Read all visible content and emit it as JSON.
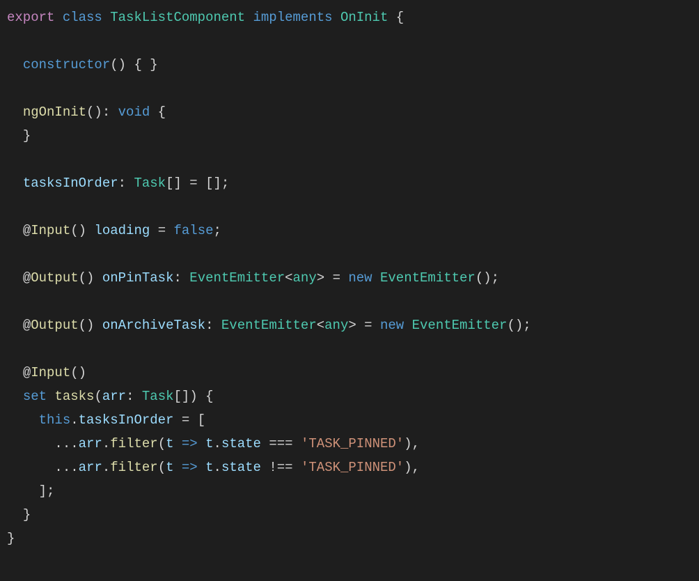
{
  "code": {
    "line1": {
      "kw_export": "export",
      "kw_class": "class",
      "class_name": "TaskListComponent",
      "kw_implements": "implements",
      "iface": "OnInit",
      "brace": "{"
    },
    "line3": {
      "ctor": "constructor",
      "parens": "()",
      "braces": "{ }"
    },
    "line5": {
      "fn": "ngOnInit",
      "parens": "()",
      "colon": ":",
      "ret": "void",
      "brace": "{"
    },
    "line6": {
      "brace": "}"
    },
    "line8": {
      "prop": "tasksInOrder",
      "colon": ":",
      "type": "Task",
      "arr": "[]",
      "eq": "=",
      "val": "[]",
      "semi": ";"
    },
    "line10": {
      "at": "@",
      "dec": "Input",
      "parens": "()",
      "prop": "loading",
      "eq": "=",
      "val": "false",
      "semi": ";"
    },
    "line12": {
      "at": "@",
      "dec": "Output",
      "parens": "()",
      "prop": "onPinTask",
      "colon": ":",
      "type": "EventEmitter",
      "lt": "<",
      "any": "any",
      "gt": ">",
      "eq": "=",
      "new": "new",
      "ctor_type": "EventEmitter",
      "call": "()",
      "semi": ";"
    },
    "line14": {
      "at": "@",
      "dec": "Output",
      "parens": "()",
      "prop": "onArchiveTask",
      "colon": ":",
      "type": "EventEmitter",
      "lt": "<",
      "any": "any",
      "gt": ">",
      "eq": "=",
      "new": "new",
      "ctor_type": "EventEmitter",
      "call": "()",
      "semi": ";"
    },
    "line16": {
      "at": "@",
      "dec": "Input",
      "parens": "()"
    },
    "line17": {
      "set": "set",
      "fn": "tasks",
      "lpar": "(",
      "param": "arr",
      "colon": ":",
      "type": "Task",
      "arr": "[]",
      "rpar": ")",
      "brace": "{"
    },
    "line18": {
      "this": "this",
      "dot": ".",
      "prop": "tasksInOrder",
      "eq": "=",
      "lbrack": "["
    },
    "line19": {
      "spread": "...",
      "arr": "arr",
      "dot": ".",
      "fn": "filter",
      "lpar": "(",
      "p": "t",
      "arrow": "=>",
      "p2": "t",
      "dot2": ".",
      "state": "state",
      "op": "===",
      "str": "'TASK_PINNED'",
      "rpar": ")",
      "comma": ","
    },
    "line20": {
      "spread": "...",
      "arr": "arr",
      "dot": ".",
      "fn": "filter",
      "lpar": "(",
      "p": "t",
      "arrow": "=>",
      "p2": "t",
      "dot2": ".",
      "state": "state",
      "op": "!==",
      "str": "'TASK_PINNED'",
      "rpar": ")",
      "comma": ","
    },
    "line21": {
      "rbrack": "]",
      "semi": ";"
    },
    "line22": {
      "brace": "}"
    },
    "line23": {
      "brace": "}"
    }
  }
}
